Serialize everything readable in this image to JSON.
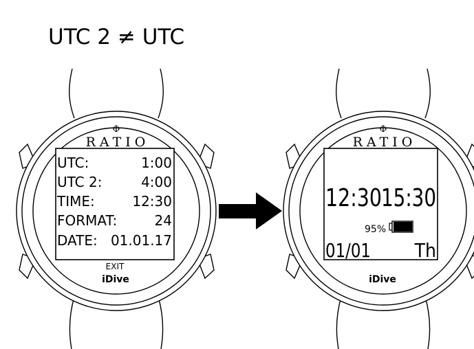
{
  "heading": "UTC 2 ≠ UTC",
  "brand_logo_symbol": "Φ",
  "brand_name": "RATIO",
  "model_name": "iDive",
  "left_watch": {
    "rows": [
      {
        "label": "UTC:",
        "value": "1:00"
      },
      {
        "label": "UTC 2:",
        "value": "4:00"
      },
      {
        "label": "TIME:",
        "value": "12:30"
      },
      {
        "label": "FORMAT:",
        "value": "24"
      },
      {
        "label": "DATE:",
        "value": "01.01.17"
      }
    ],
    "exit_label": "EXIT"
  },
  "right_watch": {
    "time_1": "12:30",
    "time_2": "15:30",
    "battery_percent": "95%",
    "battery_level": 0.95,
    "date": "01/01",
    "weekday": "Th"
  },
  "arrow_icon": "right-arrow-icon"
}
